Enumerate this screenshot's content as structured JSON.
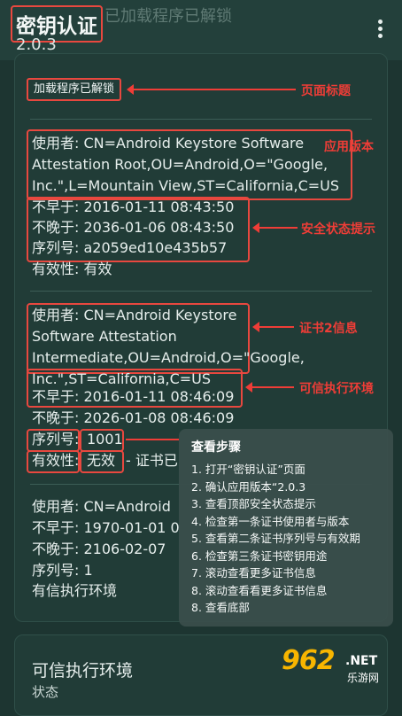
{
  "header": {
    "title": "密钥认证",
    "version": "2.0.3",
    "faded_status": "已加载程序已解锁"
  },
  "main": {
    "status_badge": "加载程序已解锁",
    "cert1": {
      "subject_l1": "使用者: CN=Android Keystore Software",
      "subject_l2": "Attestation Root,OU=Android,O=\"Google,",
      "subject_l3": "Inc.\",L=Mountain View,ST=California,C=US",
      "not_before": "不早于: 2016-01-11 08:43:50",
      "not_after": "不晚于: 2036-01-06 08:43:50",
      "serial": "序列号: a2059ed10e435b57",
      "validity": "有效性: 有效"
    },
    "cert2": {
      "subject_l1": "使用者: CN=Android Keystore",
      "subject_l2": "Software Attestation",
      "subject_l3": "Intermediate,OU=Android,O=\"Google,",
      "subject_l4": "Inc.\",ST=California,C=US",
      "not_before": "不早于: 2016-01-11 08:46:09",
      "not_after": "不晚于: 2026-01-08 08:46:09",
      "serial_label": "序列号:",
      "serial_value": "1001",
      "validity_label": "有效性:",
      "validity_value": "无效",
      "validity_note": "- 证书已"
    },
    "cert3": {
      "subject": "使用者: CN=Android",
      "not_before": "不早于: 1970-01-01 0",
      "not_after": "不晚于: 2106-02-07",
      "serial": "序列号: 1",
      "purpose": "有信执行环境"
    }
  },
  "bottom_card": {
    "title": "可信执行环境",
    "status": "状态"
  },
  "annotations": {
    "page_title": "页面标题",
    "app_version": "应用版本",
    "security_status": "安全状态提示",
    "cert2_info": "证书2信息",
    "tee": "可信执行环境"
  },
  "popup": {
    "title": "查看步骤",
    "steps": [
      "1. 打开“密钥认证”页面",
      "2. 确认应用版本“2.0.3",
      "3. 查看顶部安全状态提示",
      "4. 检查第一条证书使用者与版本",
      "5. 查看第二条证书序列号与有效期",
      "6. 检查第三条证书密钥用途",
      "7. 滚动查看更多证书信息",
      "8. 滚动查看看更多证书信息",
      "8. 查看底部"
    ]
  },
  "watermark": {
    "brand": "962",
    "domain": ".NET",
    "site": "乐游网"
  },
  "colors": {
    "background": "#1d3531",
    "card": "#213c37",
    "annotation_red": "#ef3d37"
  },
  "icons": {
    "menu": "more-vert-icon",
    "arrows": "arrow-left-icon"
  }
}
